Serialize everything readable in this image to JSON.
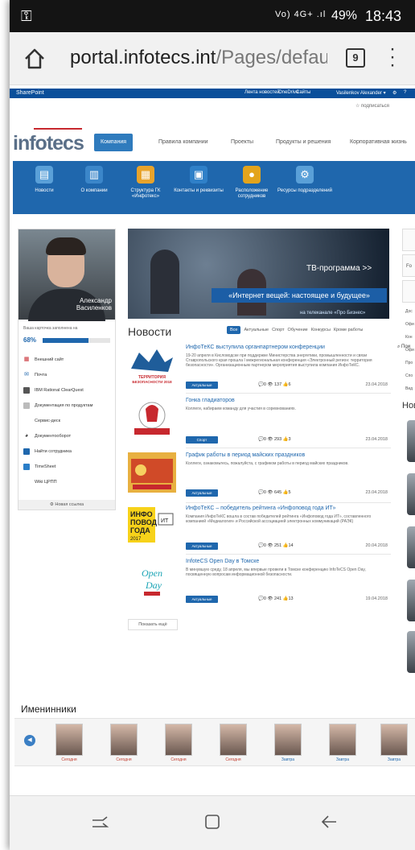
{
  "status": {
    "key_icon": "key-icon",
    "signal": "Vo) 4G+ .ıl",
    "battery": "49%",
    "time": "18:43"
  },
  "browser": {
    "url_host": "portal.infotecs.int",
    "url_path": "/Pages/default.a:",
    "tabs_count": "9"
  },
  "sharepoint": {
    "brand": "SharePoint",
    "links": [
      "Лента новостей",
      "OneDrive",
      "Сайты"
    ],
    "user": "Vasilenkov Alexander ▾",
    "follow": "☆ подписаться"
  },
  "logo": "infotecs",
  "nav": {
    "items": [
      "Компания",
      "Правила компании",
      "Проекты",
      "Продукты и решения",
      "Корпоративная жизнь"
    ]
  },
  "quick": [
    {
      "label": "Новости",
      "icon": "newspaper-icon"
    },
    {
      "label": "О компании",
      "icon": "building-icon"
    },
    {
      "label": "Структура ГК «Инфотекс»",
      "icon": "structure-icon"
    },
    {
      "label": "Контакты и реквизиты",
      "icon": "contacts-icon"
    },
    {
      "label": "Расположение сотрудников",
      "icon": "location-icon"
    },
    {
      "label": "Ресурсы подразделений",
      "icon": "gear-icon"
    }
  ],
  "search": {
    "label": "Поиск",
    "placeholder": "Пои"
  },
  "profile": {
    "name": "Александр Василенков",
    "fill_text": "Ваша карточка заполнена на",
    "percent": "68%",
    "fill_fraction": 0.68,
    "links": [
      {
        "label": "Внешний сайт",
        "icon": "grid-icon",
        "color": "#c7282e"
      },
      {
        "label": "Почта",
        "icon": "mail-icon",
        "color": "#1f67ad"
      },
      {
        "label": "IBM Rational ClearQuest",
        "icon": "db-icon",
        "color": "#555"
      },
      {
        "label": "Документация по продуктам",
        "icon": "doc-icon",
        "color": "#888"
      },
      {
        "label": "Сервис-деск",
        "icon": "blank-icon",
        "color": "#fff"
      },
      {
        "label": "Документооборот",
        "icon": "flow-icon",
        "color": "#333"
      },
      {
        "label": "Найти сотрудника",
        "icon": "person-search-icon",
        "color": "#1f67ad"
      },
      {
        "label": "TimeSheet",
        "icon": "timesheet-icon",
        "color": "#2a7ec8"
      },
      {
        "label": "Wiki ЦРПП",
        "icon": "blank-icon",
        "color": "#fff"
      }
    ],
    "new_link": "⚙ Новая ссылка"
  },
  "banner": {
    "tv": "ТВ-программа >>",
    "tag": "«Интернет вещей: настоящее и будущее»",
    "sub": "на телеканале «Про Бизнес»"
  },
  "news": {
    "heading": "Новости",
    "filters": [
      "Все",
      "Актуальные",
      "Спорт",
      "Обучение",
      "Конкурсы",
      "Кроме работы"
    ],
    "items": [
      {
        "title": "ИнфоТеКС выступила органпартнером конференции",
        "desc": "19-20 апреля в Кисловодске при поддержке Министерства энергетики, промышленности и связи Ставропольского края прошла I межрегиональная конференция «Электронный регион: территория безопасности». Организационным партнером мероприятия выступила компания ИнфоТеКС.",
        "tag": "Актуальные",
        "stats": "💬0 👁 137 👍6",
        "date": "23.04.2018",
        "thumb": "security-territory"
      },
      {
        "title": "Гонка гладиаторов",
        "desc": "Коллеги, набираем команду для участия в соревнованиях.",
        "tag": "Спорт",
        "stats": "💬0 👁 293 👍3",
        "date": "23.04.2018",
        "thumb": "gladiator"
      },
      {
        "title": "График работы в период майских праздников",
        "desc": "Коллеги, ознакомьтесь, пожалуйста, с графиком работы в период майских праздников.",
        "tag": "Актуальные",
        "stats": "💬0 👁 645 👍5",
        "date": "23.04.2018",
        "thumb": "may-holidays"
      },
      {
        "title": "ИнфоТеКС – победитель рейтинга «Инфоповод года ИТ»",
        "desc": "Компания ИнфоТеКС вошла в состав победителей рейтинга «Инфоповод года ИТ», составленного компанией «Медиалогия» и Российской ассоциацией электронных коммуникаций (РАЭК)",
        "tag": "Актуальные",
        "stats": "💬0 👁 251 👍14",
        "date": "20.04.2018",
        "thumb": "infopovod"
      },
      {
        "title": "InfoteCS Open Day в Томске",
        "desc": "В минувшую среду, 18 апреля, мы впервые провели в Томске конференцию InfoTeCS Open Day, посвященную вопросам информационной безопасности.",
        "tag": "Актуальные",
        "stats": "💬0 👁 241 👍13",
        "date": "19.04.2018",
        "thumb": "open-day"
      }
    ],
    "more": "Показать ещё"
  },
  "right": {
    "novelty": "Нов",
    "items": [
      "Дос",
      "Офи",
      "Кон",
      "Офи",
      "Про",
      "Спо",
      "Вид"
    ]
  },
  "birthdays": {
    "heading": "Именинники",
    "labels": [
      "Сегодня",
      "Сегодня",
      "Сегодня",
      "Сегодня",
      "Завтра",
      "Завтра",
      "Завтра"
    ]
  }
}
